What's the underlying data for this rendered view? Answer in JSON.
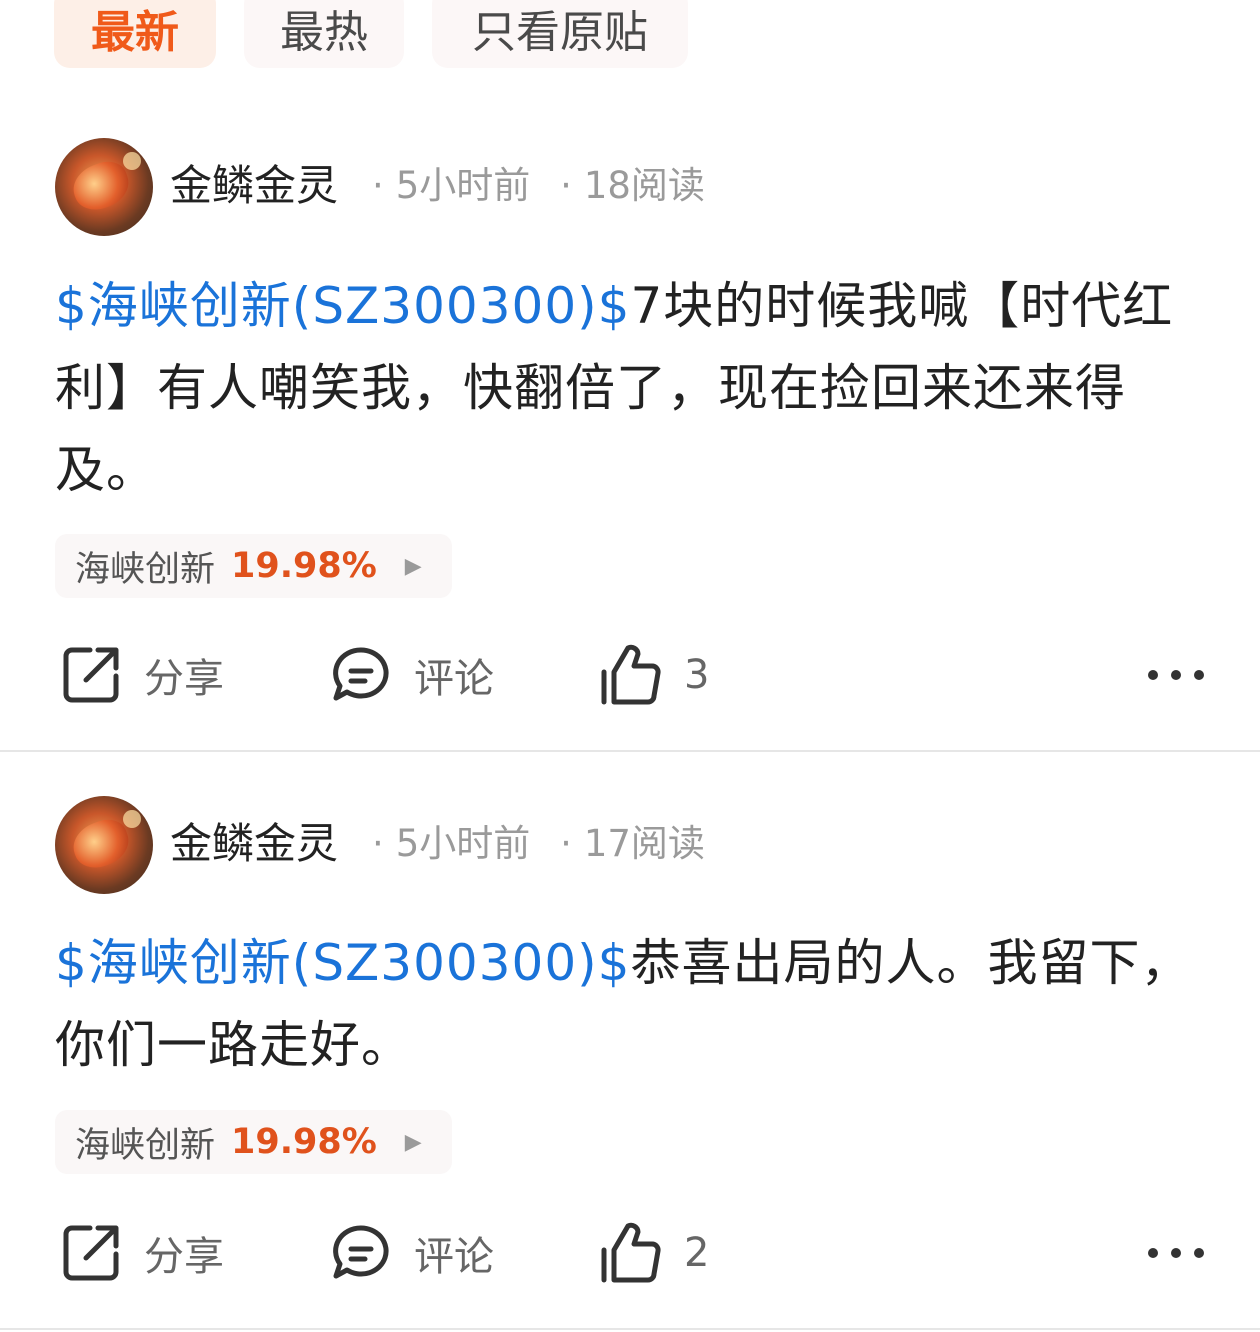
{
  "tabs": [
    {
      "label": "最新",
      "active": true
    },
    {
      "label": "最热",
      "active": false
    },
    {
      "label": "只看原贴",
      "active": false
    }
  ],
  "posts": [
    {
      "author": "金鳞金灵",
      "time": "5小时前",
      "reads": "18阅读",
      "stock_link": "$海峡创新(SZ300300)$",
      "text": "7块的时候我喊【时代红利】有人嘲笑我，快翻倍了，现在捡回来还来得及。",
      "stock_chip": {
        "name": "海峡创新",
        "change": "19.98%"
      },
      "actions": {
        "share": "分享",
        "comment": "评论",
        "likes": "3"
      }
    },
    {
      "author": "金鳞金灵",
      "time": "5小时前",
      "reads": "17阅读",
      "stock_link": "$海峡创新(SZ300300)$",
      "text": "恭喜出局的人。我留下，你们一路走好。",
      "stock_chip": {
        "name": "海峡创新",
        "change": "19.98%"
      },
      "actions": {
        "share": "分享",
        "comment": "评论",
        "likes": "2"
      }
    }
  ],
  "colors": {
    "accent": "#f05a1a",
    "link": "#1a73d9",
    "rise": "#e0521c"
  }
}
